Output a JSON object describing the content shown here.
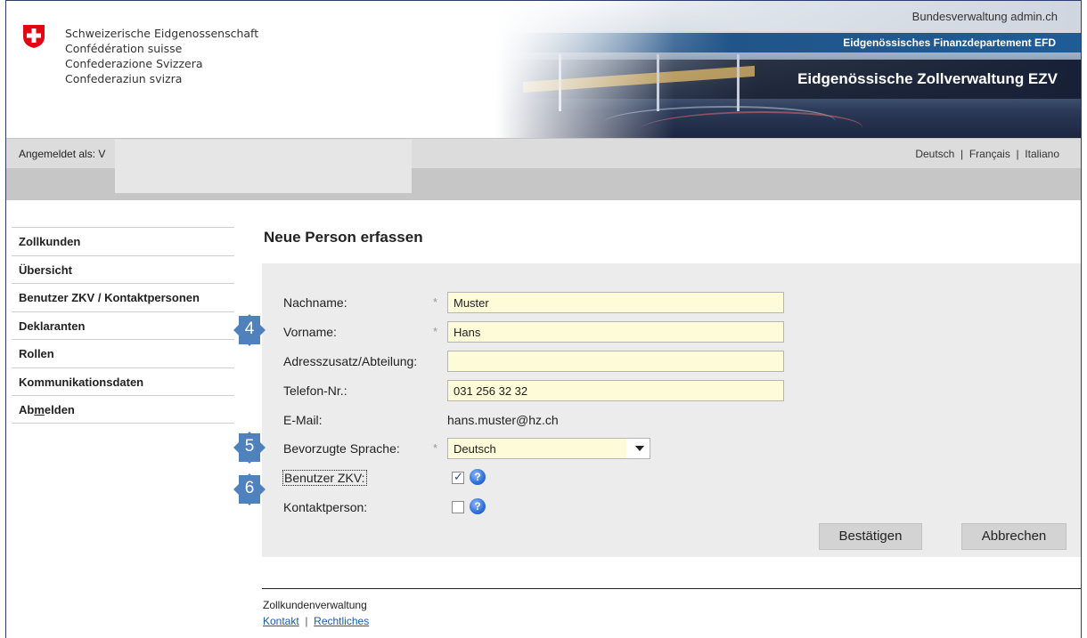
{
  "header": {
    "confederation": [
      "Schweizerische Eidgenossenschaft",
      "Confédération suisse",
      "Confederazione Svizzera",
      "Confederaziun svizra"
    ],
    "bundesverwaltung": "Bundesverwaltung admin.ch",
    "departement": "Eidgenössisches Finanzdepartement EFD",
    "amt": "Eidgenössische Zollverwaltung EZV",
    "logo_icon": "swiss-cross-icon"
  },
  "loginbar": {
    "label": "Angemeldet als: V",
    "languages": [
      "Deutsch",
      "Français",
      "Italiano"
    ],
    "separator": "|"
  },
  "sidebar": {
    "items": [
      {
        "label": "Zollkunden"
      },
      {
        "label": "Übersicht"
      },
      {
        "label": "Benutzer ZKV / Kontaktpersonen"
      },
      {
        "label": "Deklaranten"
      },
      {
        "label": "Rollen"
      },
      {
        "label": "Kommunikationsdaten"
      },
      {
        "label_pre": "Ab",
        "label_u": "m",
        "label_post": "elden"
      }
    ]
  },
  "main": {
    "title": "Neue Person erfassen",
    "required_mark": "*",
    "fields": {
      "nachname": {
        "label": "Nachname:",
        "value": "Muster"
      },
      "vorname": {
        "label": "Vorname:",
        "value": "Hans"
      },
      "adresszusatz": {
        "label": "Adresszusatz/Abteilung:",
        "value": ""
      },
      "telefon": {
        "label": "Telefon-Nr.:",
        "value": "031 256 32 32"
      },
      "email": {
        "label": "E-Mail:",
        "value": "hans.muster@hz.ch"
      },
      "sprache": {
        "label": "Bevorzugte Sprache:",
        "value": "Deutsch"
      },
      "benutzer_zkv": {
        "label": "Benutzer ZKV:",
        "checked": true
      },
      "kontaktperson": {
        "label": "Kontaktperson:",
        "checked": false
      }
    },
    "help_glyph": "?",
    "buttons": {
      "confirm": "Bestätigen",
      "cancel": "Abbrechen"
    }
  },
  "markers": [
    "4",
    "5",
    "6"
  ],
  "footer": {
    "app_name": "Zollkundenverwaltung",
    "links": [
      "Kontakt",
      "Rechtliches"
    ],
    "separator": "|"
  },
  "colors": {
    "input_bg": "#fdfbd8",
    "form_bg": "#ececec",
    "marker": "#4f81bd",
    "efd_bar": "#1f5c96",
    "swiss_red": "#e30613"
  }
}
